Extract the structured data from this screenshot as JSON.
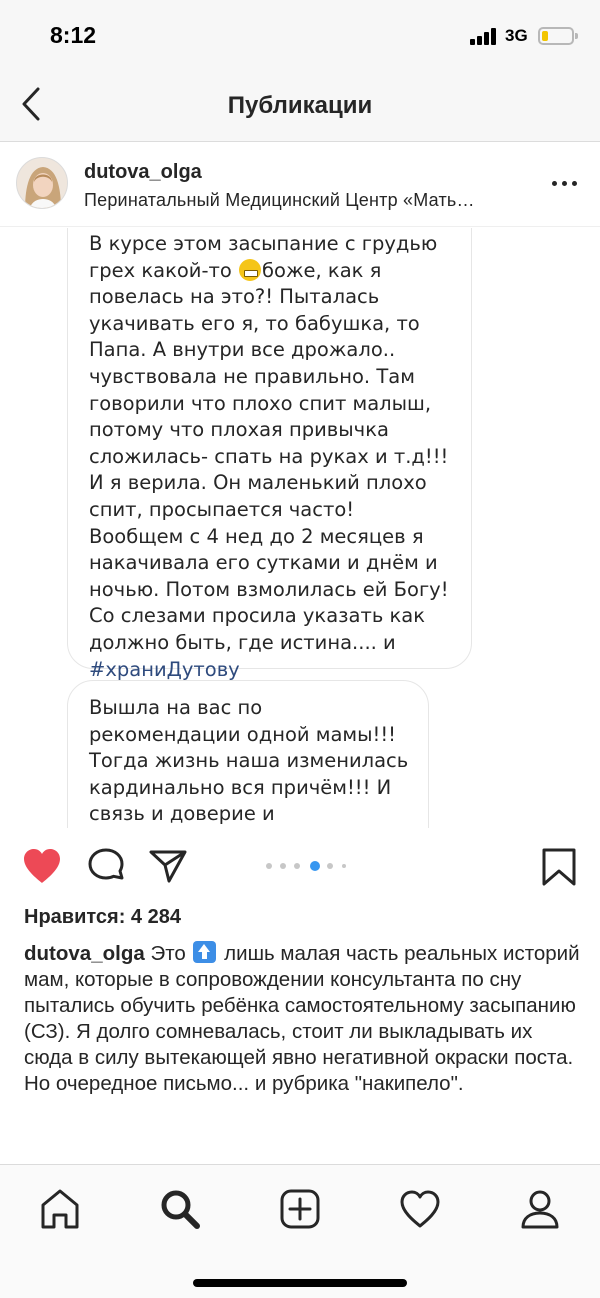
{
  "status_bar": {
    "time": "8:12",
    "network": "3G",
    "battery_level": 0.15
  },
  "nav": {
    "title": "Публикации"
  },
  "post": {
    "username": "dutova_olga",
    "location": "Перинатальный Медицинский Центр «Мать…",
    "media": {
      "bubble1": {
        "line1": "В курсе этом засыпание с грудью",
        "line2_before": "грех какой-то ",
        "line2_after": "боже, как я",
        "rest": "повелась на это?! Пыталась укачивать его я, то бабушка, то Папа. А внутри все дрожало.. чувствовала не правильно. Там говорили что плохо спит малыш, потому что плохая привычка сложилась- спать на руках и т.д!!! И я верила. Он маленький плохо спит, просыпается часто! Вообщем с 4 нед до 2 месяцев я накачивала его сутками и днём и ночью. Потом взмолилась ей Богу! Со слезами просила указать как должно быть, где истина.... и",
        "hashtag": "#храниДутову"
      },
      "bubble2": {
        "text": "Вышла на вас по рекомендации одной мамы!!! Тогда жизнь наша изменилась кардинально вся причём!!! И связь и доверие и спокойствие мамы и малыша!"
      },
      "carousel_total": 6,
      "carousel_active": 4
    },
    "likes": "Нравится: 4 284",
    "caption": {
      "username": "dutova_olga",
      "before_emoji": "Это",
      "after_emoji": "лишь малая часть реальных историй мам, которые в сопровождении консультанта по сну пытались обучить ребёнка самостоятельному засыпанию (СЗ). Я долго сомневалась, стоит ли выкладывать их сюда в силу вытекающей явно негативной окраски поста. Но очередное письмо... и рубрика \"накипело\"."
    }
  },
  "icons": {
    "back": "chevron-left-icon",
    "more": "more-horizontal-icon",
    "like": "heart-filled-icon",
    "comment": "comment-icon",
    "share": "paper-plane-icon",
    "save": "bookmark-icon",
    "tabs": [
      "home-icon",
      "search-icon",
      "new-post-icon",
      "activity-heart-icon",
      "profile-icon"
    ]
  },
  "colors": {
    "like": "#ed4956",
    "hashtag": "#2e4a7d",
    "carousel_active": "#3897f0",
    "battery": "#f2c500"
  }
}
